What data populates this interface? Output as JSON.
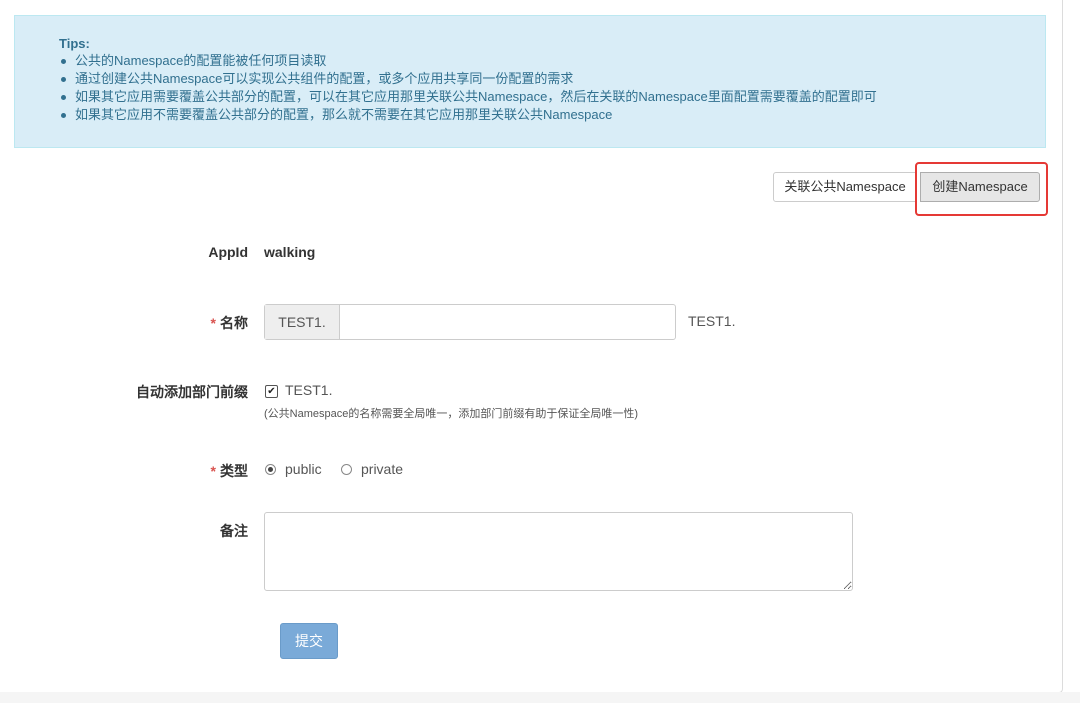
{
  "tips": {
    "title": "Tips:",
    "items": [
      "公共的Namespace的配置能被任何项目读取",
      "通过创建公共Namespace可以实现公共组件的配置，或多个应用共享同一份配置的需求",
      "如果其它应用需要覆盖公共部分的配置，可以在其它应用那里关联公共Namespace，然后在关联的Namespace里面配置需要覆盖的配置即可",
      "如果其它应用不需要覆盖公共部分的配置，那么就不需要在其它应用那里关联公共Namespace"
    ]
  },
  "toolbar": {
    "link_namespace_label": "关联公共Namespace",
    "create_namespace_label": "创建Namespace"
  },
  "form": {
    "appid_label": "AppId",
    "appid_value": "walking",
    "required_mark": "*",
    "name_label": "名称",
    "name_prefix": "TEST1.",
    "name_value": "",
    "name_hint": "TEST1.",
    "auto_prefix_label": "自动添加部门前缀",
    "auto_prefix_checked": true,
    "auto_prefix_value": "TEST1.",
    "auto_prefix_note": "(公共Namespace的名称需要全局唯一，添加部门前缀有助于保证全局唯一性)",
    "type_label": "类型",
    "type_options": [
      "public",
      "private"
    ],
    "type_selected": "public",
    "remark_label": "备注",
    "remark_value": "",
    "submit_label": "提交"
  },
  "colors": {
    "tips_bg": "#d9edf7",
    "tips_text": "#31708f",
    "highlight_border": "#e53935",
    "submit_bg": "#7aaad8",
    "required": "#d9534f"
  }
}
